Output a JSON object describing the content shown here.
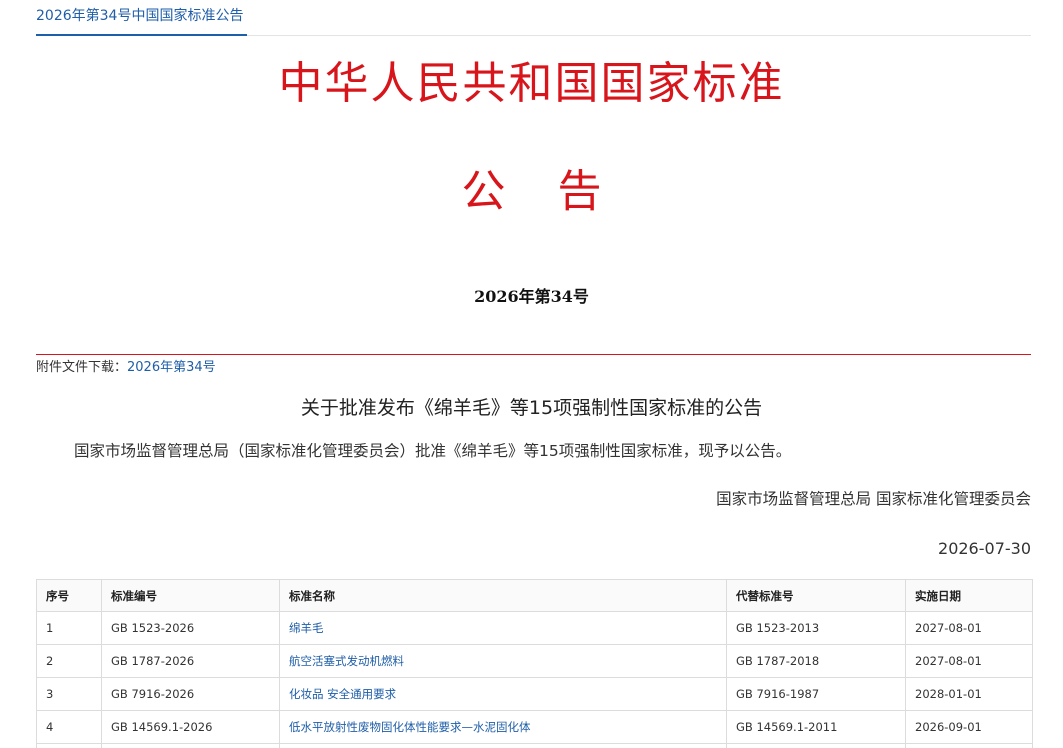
{
  "breadcrumb": "2026年第34号中国国家标准公告",
  "red_title": "中华人民共和国国家标准",
  "gonggao": [
    "公",
    "告"
  ],
  "issue_number": "2026年第34号",
  "attachment": {
    "label": "附件文件下载：",
    "link_text": "2026年第34号"
  },
  "notice_title": "关于批准发布《绵羊毛》等15项强制性国家标准的公告",
  "body_text": "国家市场监督管理总局（国家标准化管理委员会）批准《绵羊毛》等15项强制性国家标准，现予以公告。",
  "issuer": "国家市场监督管理总局 国家标准化管理委员会",
  "date": "2026-07-30",
  "table": {
    "headers": [
      "序号",
      "标准编号",
      "标准名称",
      "代替标准号",
      "实施日期"
    ],
    "rows": [
      [
        "1",
        "GB 1523-2026",
        "绵羊毛",
        "GB 1523-2013",
        "2027-08-01"
      ],
      [
        "2",
        "GB 1787-2026",
        "航空活塞式发动机燃料",
        "GB 1787-2018",
        "2027-08-01"
      ],
      [
        "3",
        "GB 7916-2026",
        "化妆品 安全通用要求",
        "GB 7916-1987",
        "2028-01-01"
      ],
      [
        "4",
        "GB 14569.1-2026",
        "低水平放射性废物固化体性能要求—水泥固化体",
        "GB 14569.1-2011",
        "2026-09-01"
      ],
      [
        "5",
        "",
        "",
        "",
        ""
      ]
    ]
  }
}
